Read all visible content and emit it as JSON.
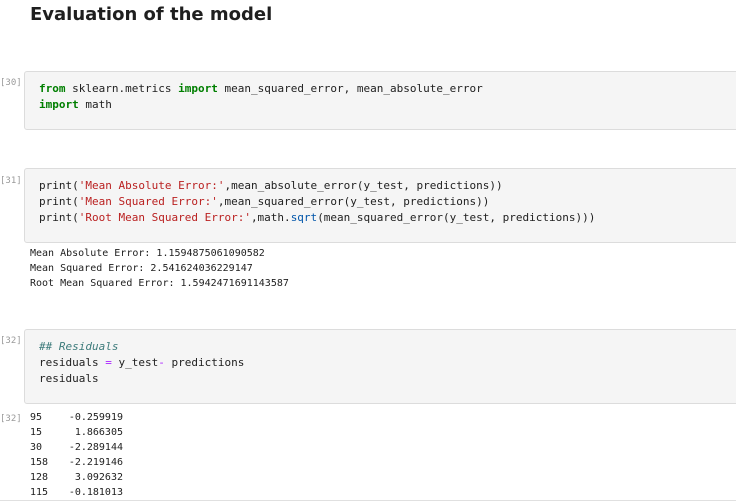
{
  "heading": "Evaluation of the model",
  "cells": [
    {
      "prompt": "[30]:",
      "lines": [
        [
          {
            "t": "from",
            "c": "kw"
          },
          {
            "t": " sklearn.metrics ",
            "c": ""
          },
          {
            "t": "import",
            "c": "kw"
          },
          {
            "t": " mean_squared_error, mean_absolute_error",
            "c": ""
          }
        ],
        [
          {
            "t": "import",
            "c": "kw"
          },
          {
            "t": " math",
            "c": ""
          }
        ]
      ]
    },
    {
      "prompt": "[31]:",
      "lines": [
        [
          {
            "t": "print(",
            "c": ""
          },
          {
            "t": "'Mean Absolute Error:'",
            "c": "str"
          },
          {
            "t": ",mean_absolute_error(y_test, predictions))",
            "c": ""
          }
        ],
        [
          {
            "t": "print(",
            "c": ""
          },
          {
            "t": "'Mean Squared Error:'",
            "c": "str"
          },
          {
            "t": ",mean_squared_error(y_test, predictions))",
            "c": ""
          }
        ],
        [
          {
            "t": "print(",
            "c": ""
          },
          {
            "t": "'Root Mean Squared Error:'",
            "c": "str"
          },
          {
            "t": ",math.",
            "c": ""
          },
          {
            "t": "sqrt",
            "c": "fn"
          },
          {
            "t": "(mean_squared_error(y_test, predictions)))",
            "c": ""
          }
        ]
      ]
    },
    {
      "prompt": "[32]:",
      "lines": [
        [
          {
            "t": "## Residuals",
            "c": "cm"
          }
        ],
        [
          {
            "t": "residuals ",
            "c": ""
          },
          {
            "t": "=",
            "c": "op"
          },
          {
            "t": " y_test",
            "c": ""
          },
          {
            "t": "-",
            "c": "op"
          },
          {
            "t": " predictions",
            "c": ""
          }
        ],
        [
          {
            "t": "residuals",
            "c": ""
          }
        ]
      ]
    }
  ],
  "output_31": [
    "Mean Absolute Error: 1.1594875061090582",
    "Mean Squared Error: 2.541624036229147",
    "Root Mean Squared Error: 1.5942471691143587"
  ],
  "output_32_prompt": "[32]:",
  "output_32": [
    {
      "index": "95",
      "value": "-0.259919"
    },
    {
      "index": "15",
      "value": "1.866305"
    },
    {
      "index": "30",
      "value": "-2.289144"
    },
    {
      "index": "158",
      "value": "-2.219146"
    },
    {
      "index": "128",
      "value": "3.092632"
    },
    {
      "index": "115",
      "value": "-0.181013"
    }
  ]
}
